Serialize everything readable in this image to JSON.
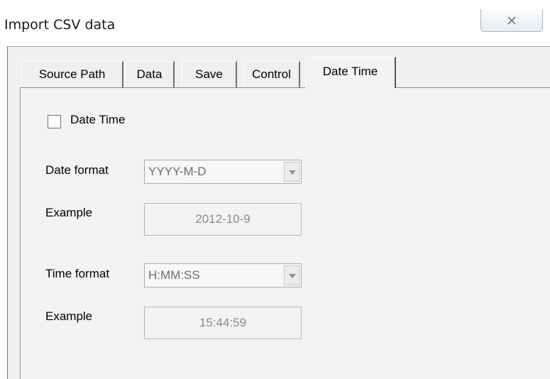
{
  "window": {
    "title": "Import CSV data",
    "close_glyph": "☒"
  },
  "tabs": [
    {
      "label": "Source Path"
    },
    {
      "label": "Data"
    },
    {
      "label": "Save"
    },
    {
      "label": "Control"
    },
    {
      "label": "Date Time",
      "active": true
    }
  ],
  "date_time": {
    "checkbox_label": "Date Time",
    "checked": false,
    "date_format_label": "Date format",
    "date_format_value": "YYYY-M-D",
    "date_example_label": "Example",
    "date_example_value": "2012-10-9",
    "time_format_label": "Time format",
    "time_format_value": "H:MM:SS",
    "time_example_label": "Example",
    "time_example_value": "15:44:59"
  },
  "icons": {
    "close": "close-icon",
    "dropdown": "chevron-down-icon"
  }
}
